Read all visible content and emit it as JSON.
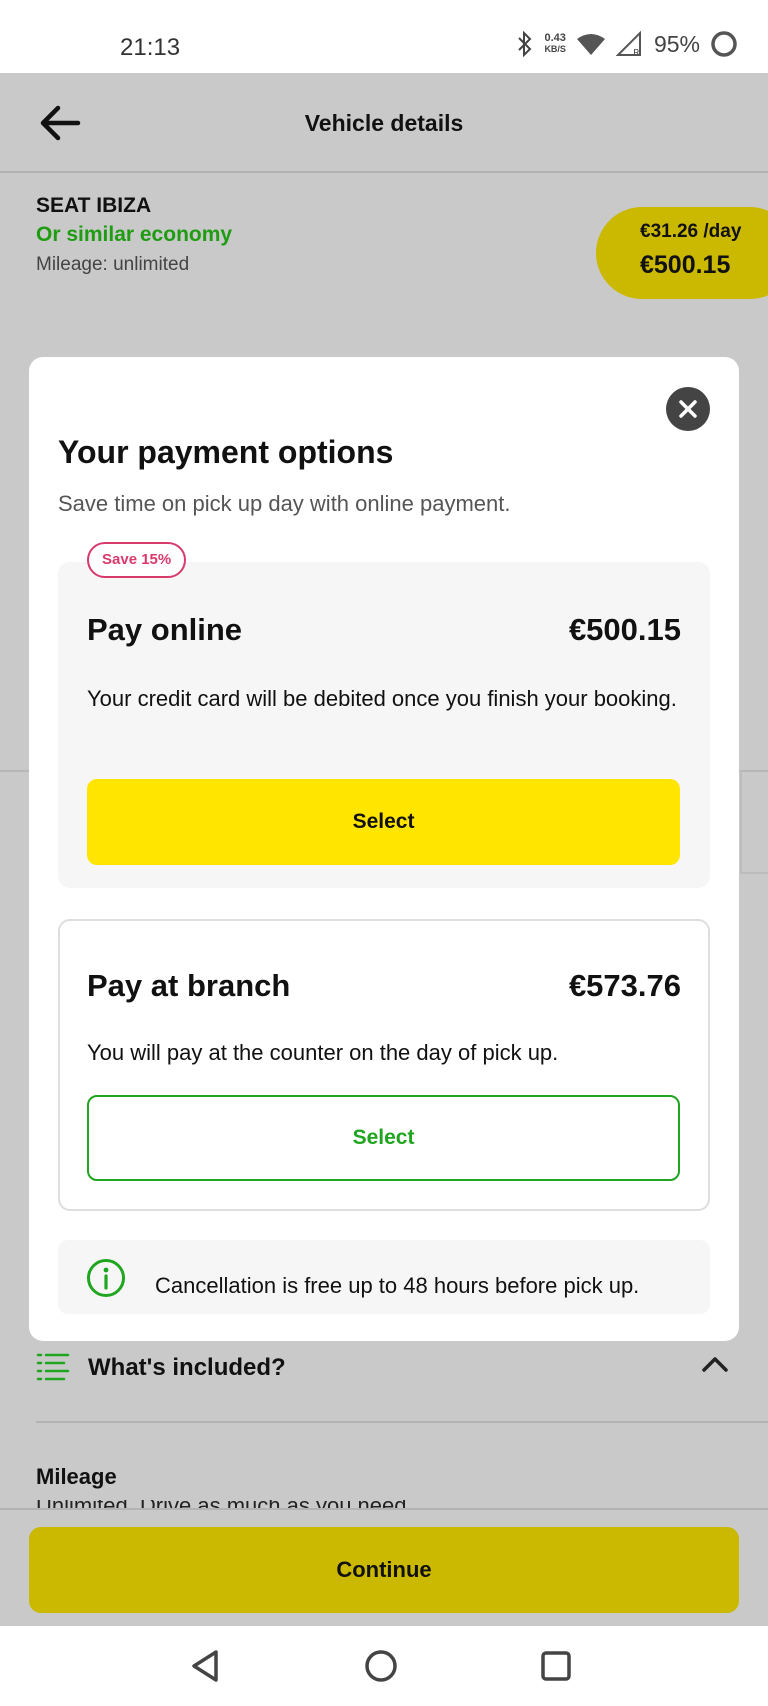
{
  "status_bar": {
    "time": "21:13",
    "net_speed_value": "0.43",
    "net_speed_unit": "KB/S",
    "battery": "95%"
  },
  "header": {
    "title": "Vehicle details"
  },
  "vehicle": {
    "name": "SEAT IBIZA",
    "similar": "Or similar economy",
    "mileage": "Mileage: unlimited",
    "price_per_day": "€31.26 /day",
    "price_total": "€500.15"
  },
  "modal": {
    "title": "Your payment options",
    "subtitle": "Save time on pick up day with online payment.",
    "online": {
      "badge": "Save 15%",
      "title": "Pay online",
      "price": "€500.15",
      "description": "Your credit card will be debited once you finish your booking.",
      "select_label": "Select"
    },
    "branch": {
      "title": "Pay at branch",
      "price": "€573.76",
      "description": "You will pay at the counter on the day of pick up.",
      "select_label": "Select"
    },
    "cancellation": "Cancellation is free up to 48 hours before pick up."
  },
  "included": {
    "title": "What's included?",
    "mileage_label": "Mileage",
    "mileage_peek": "Unlimited. Drive as much as you need"
  },
  "footer": {
    "continue_label": "Continue"
  },
  "colors": {
    "accent_yellow": "#ffe500",
    "dim_yellow": "#cbb800",
    "green": "#1fa51f",
    "badge_pink": "#d83a6c"
  }
}
